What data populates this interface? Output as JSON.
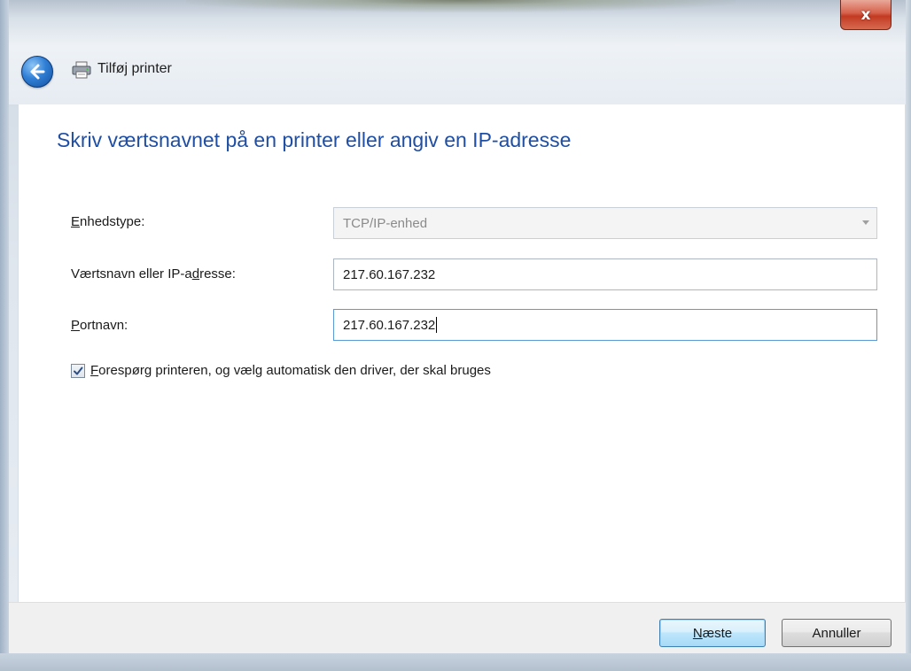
{
  "window": {
    "close_label": "x"
  },
  "nav": {
    "title": "Tilføj printer"
  },
  "main": {
    "heading": "Skriv værtsnavnet på en printer eller angiv en IP-adresse",
    "device_type": {
      "label_accel": "E",
      "label_rest": "nhedstype:",
      "value": "TCP/IP-enhed"
    },
    "hostname": {
      "label_pre": "Værtsnavn eller IP-a",
      "label_accel": "d",
      "label_post": "resse:",
      "value": "217.60.167.232"
    },
    "port": {
      "label_accel": "P",
      "label_rest": "ortnavn:",
      "value": "217.60.167.232"
    },
    "query_printer": {
      "checked": true,
      "label_accel": "F",
      "label_rest": "orespørg printeren, og vælg automatisk den driver, der skal bruges"
    }
  },
  "footer": {
    "next_accel": "N",
    "next_rest": "æste",
    "cancel_label": "Annuller"
  },
  "colors": {
    "heading": "#1f4ea3",
    "close_button": "#c23a22",
    "primary_button_border": "#3c7fb1"
  },
  "icons": {
    "back": "back-arrow-icon",
    "printer": "printer-icon",
    "check": "checkmark-icon",
    "dropdown": "chevron-down-icon"
  }
}
